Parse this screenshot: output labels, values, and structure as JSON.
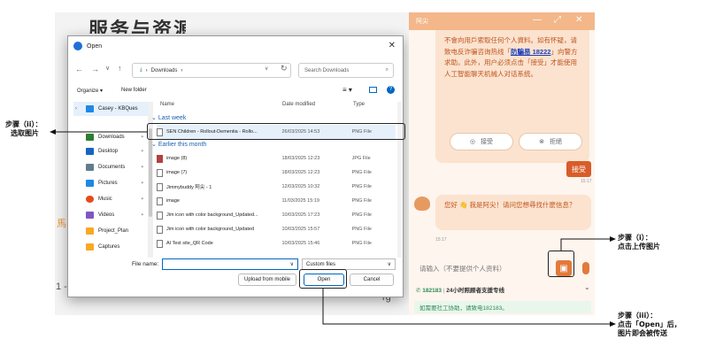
{
  "background": {
    "title_fragment": "服务与资源",
    "left_fragment": "馬",
    "dash": "1 -",
    "right_fragment": "rg"
  },
  "dialog": {
    "title": "Open",
    "close": "✕",
    "path": "Downloads",
    "search_placeholder": "Search Downloads",
    "organize": "Organize ▾",
    "new_folder": "New folder",
    "columns": {
      "name": "Name",
      "date": "Date modified",
      "type": "Type"
    },
    "groups": {
      "last_week": "Last week",
      "earlier": "Earlier this month"
    },
    "sidebar": [
      {
        "label": "Casey - KBQues",
        "color": "#1e88e5"
      },
      {
        "label": "Downloads",
        "color": "#2e7d32"
      },
      {
        "label": "Desktop",
        "color": "#1565c0"
      },
      {
        "label": "Documents",
        "color": "#607d8b"
      },
      {
        "label": "Pictures",
        "color": "#1e88e5"
      },
      {
        "label": "Music",
        "color": "#e64a19"
      },
      {
        "label": "Videos",
        "color": "#7e57c2"
      },
      {
        "label": "Project_Plan",
        "color": "#f9a825"
      },
      {
        "label": "Captures",
        "color": "#f9a825"
      }
    ],
    "files_last_week": [
      {
        "name": "SEN Children - Rollout-Dementia - Rollo...",
        "date": "26/03/2025 14:53",
        "type": "PNG File"
      }
    ],
    "files_earlier": [
      {
        "name": "image (8)",
        "date": "18/03/2025 12:23",
        "type": "JPG File"
      },
      {
        "name": "image (7)",
        "date": "18/03/2025 12:23",
        "type": "PNG File"
      },
      {
        "name": "Jimmybuddy 阿尖 - 1",
        "date": "12/03/2025 10:32",
        "type": "PNG File"
      },
      {
        "name": "image",
        "date": "11/03/2025 15:19",
        "type": "PNG File"
      },
      {
        "name": "Jim icon with color background_Updated...",
        "date": "10/03/2025 17:23",
        "type": "PNG File"
      },
      {
        "name": "Jim icon with color background_Updated",
        "date": "10/03/2025 15:57",
        "type": "PNG File"
      },
      {
        "name": "AI Test site_QR Code",
        "date": "10/03/2025 15:46",
        "type": "PNG File"
      }
    ],
    "file_name_label": "File name:",
    "file_name_value": "",
    "file_type": "Custom files",
    "upload_mobile": "Upload from mobile",
    "open": "Open",
    "cancel": "Cancel"
  },
  "chat": {
    "title": "阿尖",
    "bubble1_a": "不會向用戶索取任何个人資料。如有怀疑，请致电反诈骗咨询热线「",
    "bubble1_link": "防騙易 18222",
    "bubble1_b": "」向警方求助。此外，用户必须点击「接受」才能使用人工智能聊天机械人对话系统。",
    "accept_pill": "接受",
    "reject_pill": "拒絕",
    "accept_button": "接受",
    "time1": "15:17",
    "greeting": "您好 👋 我是阿尖！请问您想尋找什麼信息？",
    "time2": "15:17",
    "input_placeholder": "请输入（不要提供个人资料）",
    "hotline_number": "182183",
    "hotline_text": "24小时照顾者支援专线",
    "social_note": "如需要社工协助，请致电182183。"
  },
  "annotations": {
    "step2_title": "步骤（ii）：",
    "step2_text": "选取图片",
    "step1_title": "步骤（i）：",
    "step1_text": "点击上传图片",
    "step3_title": "步骤（iii）：",
    "step3_text": "点击「Open」后，",
    "step3_text2": "图片即会被传送"
  }
}
